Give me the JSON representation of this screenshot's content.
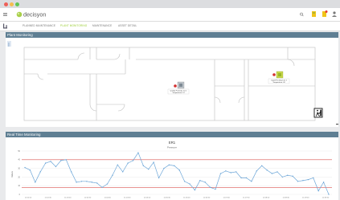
{
  "app": {
    "brand": "decisyon",
    "menu_icon": "hamburger-icon",
    "logo_icon": "globe-icon"
  },
  "header_icons": [
    "search-icon",
    "badge-icon-1",
    "badge-icon-2",
    "user-icon"
  ],
  "tabs": [
    {
      "label": "PLANNED MAINTENANCE",
      "active": false
    },
    {
      "label": "PLANT MONITORING",
      "active": true
    },
    {
      "label": "MAINTENANCE",
      "active": false
    },
    {
      "label": "ASSET DETAIL",
      "active": false
    }
  ],
  "plant_panel": {
    "title": "Plant Monitoring",
    "legend_marker": "|"
  },
  "assets": [
    {
      "label_line1": "Quality Packing Line 1",
      "label_line2": "Temperature: 14"
    },
    {
      "label_line1": "Liquid Packing Line 1",
      "label_line2": "Temperature: 44"
    }
  ],
  "realtime_panel": {
    "title": "Real Time Monitoring"
  },
  "chart_data": {
    "type": "line",
    "title": "ER1",
    "subtitle": "Pressure",
    "ylabel": "Values",
    "ylim": [
      0,
      50
    ],
    "yticks": [
      0,
      10,
      20,
      30,
      40,
      50
    ],
    "x": [
      "11:02:00",
      "11:02:15",
      "11:02:30",
      "11:02:45",
      "11:03:00",
      "11:03:15",
      "11:03:30",
      "11:03:45",
      "11:04:00",
      "11:04:15",
      "11:04:30",
      "11:04:45",
      "11:05:00",
      "11:05:15",
      "11:05:30",
      "11:05:45",
      "11:06:00",
      "11:06:15",
      "11:06:30",
      "11:06:45",
      "11:07:00",
      "11:07:15",
      "11:07:30",
      "11:07:45",
      "11:08:00",
      "11:08:15",
      "11:08:30",
      "11:08:45",
      "11:09:00",
      "11:09:15",
      "11:09:30",
      "11:09:45"
    ],
    "xticks": [
      "11:02:00",
      "11:02:30",
      "11:03:00",
      "11:03:30",
      "11:04:00",
      "11:04:30",
      "11:05:00",
      "11:05:30",
      "11:06:00",
      "11:06:30",
      "11:07:00",
      "11:07:30",
      "11:08:00",
      "11:08:30",
      "11:09:00",
      "11:09:30"
    ],
    "series": [
      {
        "values": [
          31,
          28,
          14,
          26,
          36,
          38,
          32,
          39,
          40,
          26,
          14,
          15,
          15,
          14,
          13,
          8,
          12,
          22,
          34,
          26,
          36,
          39,
          48,
          33,
          29,
          37,
          19,
          30,
          34,
          33,
          28,
          15,
          12,
          5,
          16,
          14,
          8,
          6,
          24,
          27,
          25,
          26,
          19,
          19,
          15,
          27,
          33,
          28,
          24,
          26,
          20,
          22,
          21,
          15,
          16,
          17,
          19,
          4,
          14,
          0
        ],
        "color": "#6ea7d8"
      }
    ],
    "thresholds": [
      {
        "value": 40,
        "color": "#d9534f"
      },
      {
        "value": 8,
        "color": "#d9534f"
      }
    ]
  },
  "colors": {
    "accent": "#9acd32",
    "panel_header": "#5f7f93",
    "series": "#6ea7d8",
    "threshold": "#d9534f"
  }
}
